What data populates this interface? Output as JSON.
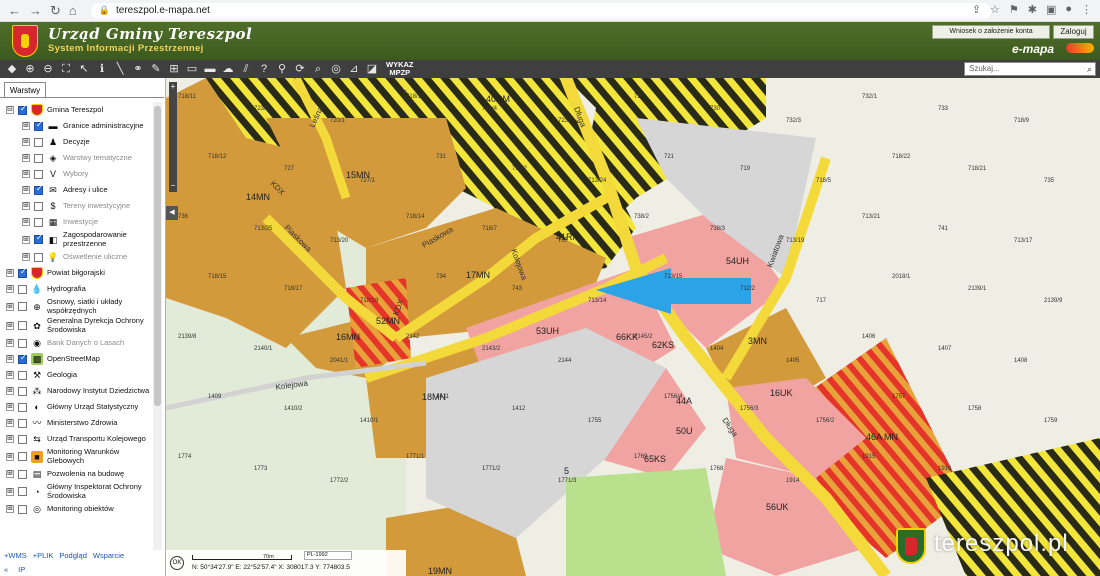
{
  "browser": {
    "url": "tereszpol.e-mapa.net",
    "nav": [
      "←",
      "→",
      "↻",
      "⌂"
    ],
    "tools": [
      "⇪",
      "☆",
      "⚑",
      "✱",
      "▣",
      "●",
      "⋮"
    ]
  },
  "header": {
    "title": "Urząd Gminy Tereszpol",
    "subtitle": "System Informacji Przestrzennej",
    "account_button": "Wniosek o założenie konta",
    "login_button": "Zaloguj",
    "brand": "e-mapa"
  },
  "toolbar": {
    "icons": [
      "◆",
      "⊕",
      "⊖",
      "⛶",
      "↖",
      "ℹ",
      "╲",
      "⚭",
      "✎",
      "⊞",
      "▭",
      "▬",
      "☁",
      "⫽",
      "?",
      "⚲",
      "⟳",
      "⌕",
      "◎",
      "⊿",
      "◪"
    ],
    "wykaz_label_1": "WYKAZ",
    "wykaz_label_2": "MPZP",
    "search_placeholder": "Szukaj...",
    "search_icon": "magnifier-icon"
  },
  "panel": {
    "tab_label": "Warstwy",
    "layers": [
      {
        "level": 0,
        "exp": "⊟",
        "checked": true,
        "icon": "crest",
        "icon_bg": "#d7262c",
        "label": "Gmina Tereszpol",
        "dim": false
      },
      {
        "level": 1,
        "exp": "⊞",
        "checked": true,
        "icon": "▬",
        "icon_bg": "#ffffff",
        "label": "Granice administracyjne",
        "dim": false
      },
      {
        "level": 1,
        "exp": "⊞",
        "checked": false,
        "icon": "♟",
        "icon_bg": "#ffffff",
        "label": "Decyzje",
        "dim": false
      },
      {
        "level": 1,
        "exp": "⊞",
        "checked": false,
        "icon": "◈",
        "icon_bg": "#ffffff",
        "label": "Warstwy tematyczne",
        "dim": true
      },
      {
        "level": 1,
        "exp": "⊞",
        "checked": false,
        "icon": "V",
        "icon_bg": "#ffffff",
        "label": "Wybory",
        "dim": true
      },
      {
        "level": 1,
        "exp": "⊞",
        "checked": true,
        "icon": "✉",
        "icon_bg": "#ffffff",
        "label": "Adresy i ulice",
        "dim": false
      },
      {
        "level": 1,
        "exp": "⊞",
        "checked": false,
        "icon": "$",
        "icon_bg": "#ffffff",
        "label": "Tereny inwestycyjne",
        "dim": true
      },
      {
        "level": 1,
        "exp": "⊞",
        "checked": false,
        "icon": "▦",
        "icon_bg": "#ffffff",
        "label": "Inwestycje",
        "dim": true
      },
      {
        "level": 1,
        "exp": "⊞",
        "checked": true,
        "icon": "◧",
        "icon_bg": "#ffffff",
        "label": "Zagospodarowanie przestrzenne",
        "dim": false
      },
      {
        "level": 1,
        "exp": "⊞",
        "checked": false,
        "icon": "💡",
        "icon_bg": "#ffffff",
        "label": "Oświetlenie uliczne",
        "dim": true
      },
      {
        "level": 0,
        "exp": "⊞",
        "checked": true,
        "icon": "crest",
        "icon_bg": "#d7262c",
        "label": "Powiat biłgorajski",
        "dim": false
      },
      {
        "level": 0,
        "exp": "⊞",
        "checked": false,
        "icon": "💧",
        "icon_bg": "#ffffff",
        "label": "Hydrografia",
        "dim": false
      },
      {
        "level": 0,
        "exp": "⊞",
        "checked": false,
        "icon": "⊕",
        "icon_bg": "#ffffff",
        "label": "Osnowy, siatki i układy współrzędnych",
        "dim": false
      },
      {
        "level": 0,
        "exp": "⊞",
        "checked": false,
        "icon": "✿",
        "icon_bg": "#ffffff",
        "label": "Generalna Dyrekcja Ochrony Środowiska",
        "dim": false
      },
      {
        "level": 0,
        "exp": "⊞",
        "checked": false,
        "icon": "◉",
        "icon_bg": "#ffffff",
        "label": "Bank Danych o Lasach",
        "dim": true
      },
      {
        "level": 0,
        "exp": "⊞",
        "checked": true,
        "icon": "▩",
        "icon_bg": "#9ecc62",
        "label": "OpenStreetMap",
        "dim": false
      },
      {
        "level": 0,
        "exp": "⊞",
        "checked": false,
        "icon": "⚒",
        "icon_bg": "#ffffff",
        "label": "Geologia",
        "dim": false
      },
      {
        "level": 0,
        "exp": "⊞",
        "checked": false,
        "icon": "⁂",
        "icon_bg": "#ffffff",
        "label": "Narodowy Instytut Dziedzictwa",
        "dim": false
      },
      {
        "level": 0,
        "exp": "⊞",
        "checked": false,
        "icon": "◐",
        "icon_bg": "#ffffff",
        "label": "Główny Urząd Statystyczny",
        "dim": false
      },
      {
        "level": 0,
        "exp": "⊞",
        "checked": false,
        "icon": "〰",
        "icon_bg": "#ffffff",
        "label": "Ministerstwo Zdrowia",
        "dim": false
      },
      {
        "level": 0,
        "exp": "⊞",
        "checked": false,
        "icon": "⇆",
        "icon_bg": "#ffffff",
        "label": "Urząd Transportu Kolejowego",
        "dim": false
      },
      {
        "level": 0,
        "exp": "⊞",
        "checked": false,
        "icon": "■",
        "icon_bg": "#f0a020",
        "label": "Monitoring Warunków Glebowych",
        "dim": false
      },
      {
        "level": 0,
        "exp": "⊞",
        "checked": false,
        "icon": "▤",
        "icon_bg": "#ffffff",
        "label": "Pozwolenia na budowę",
        "dim": false
      },
      {
        "level": 0,
        "exp": "⊞",
        "checked": false,
        "icon": "◔",
        "icon_bg": "#ffffff",
        "label": "Główny Inspektorat Ochrony Środowiska",
        "dim": false
      },
      {
        "level": 0,
        "exp": "⊞",
        "checked": false,
        "icon": "◎",
        "icon_bg": "#ffffff",
        "label": "Monitoring obiektów",
        "dim": false
      }
    ],
    "footer_links": [
      "+WMS",
      "+PLIK",
      "Podgląd",
      "Wsparcie"
    ],
    "footer_links_2": [
      "«",
      "IP"
    ]
  },
  "map": {
    "zoom_in": "+",
    "zoom_out": "−",
    "collapse": "◀",
    "status": {
      "ok": "OK",
      "scale": "70m",
      "crs": "PL-1992",
      "coords": "N: 50°34'27.9\"  E: 22°52'57.4\"  X: 308017.3  Y: 774803.5"
    },
    "watermark": "tereszpol.pl",
    "zone_labels": [
      "40RM",
      "15MN",
      "14MN",
      "17MN",
      "41RM",
      "52MN",
      "16MN",
      "53UH",
      "66KK",
      "62KS",
      "18MN",
      "54UH",
      "3MN",
      "16UK",
      "44A",
      "50U",
      "46A MN",
      "65KS",
      "56UK",
      "19MN",
      "5"
    ],
    "street_labels": [
      "Leśna",
      "Piaskowa",
      "Piaskowa",
      "Kolejowa",
      "Długa",
      "Długa",
      "Kolejowa",
      "Kwiatowa",
      "KDX",
      "KDX",
      "KDX"
    ],
    "parcel_labels": [
      "718/11",
      "723/2",
      "720/1",
      "718/10",
      "722/4",
      "723",
      "729",
      "730",
      "732/3",
      "732/1",
      "733",
      "718/9",
      "718/12",
      "727",
      "727/1",
      "731",
      "732/2",
      "713/24",
      "721",
      "719",
      "718/5",
      "718/22",
      "718/21",
      "735",
      "736",
      "713/25",
      "713/20",
      "718/14",
      "718/7",
      "737",
      "738/2",
      "738/3",
      "713/19",
      "713/21",
      "741",
      "713/17",
      "718/15",
      "718/17",
      "718/18",
      "734",
      "743",
      "713/14",
      "713/15",
      "712/2",
      "717",
      "2018/1",
      "2139/1",
      "2139/9",
      "2139/8",
      "2140/1",
      "2041/1",
      "2142",
      "2143/2",
      "2144",
      "2145/2",
      "1404",
      "1405",
      "1406",
      "1407",
      "1408",
      "1409",
      "1410/2",
      "1410/1",
      "1411",
      "1412",
      "1755",
      "1756/4",
      "1756/3",
      "1756/2",
      "1757",
      "1758",
      "1759",
      "1774",
      "1773",
      "1772/2",
      "1771/1",
      "1771/2",
      "1771/3",
      "1769",
      "1768",
      "1914",
      "1915",
      "1916"
    ]
  }
}
